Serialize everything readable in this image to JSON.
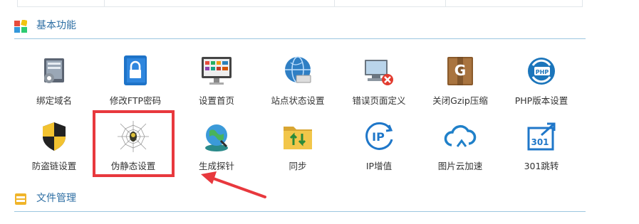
{
  "sections": {
    "basic": {
      "title": "基本功能",
      "icon": "grid-colorful-icon"
    },
    "files": {
      "title": "文件管理",
      "icon": "folder-cabinet-icon"
    }
  },
  "row1": [
    {
      "label": "绑定域名",
      "icon": "domain-bind-icon"
    },
    {
      "label": "修改FTP密码",
      "icon": "lock-icon"
    },
    {
      "label": "设置首页",
      "icon": "monitor-icon"
    },
    {
      "label": "站点状态设置",
      "icon": "globe-icon"
    },
    {
      "label": "错误页面定义",
      "icon": "error-computer-icon"
    },
    {
      "label": "关闭Gzip压缩",
      "icon": "gzip-box-icon"
    },
    {
      "label": "PHP版本设置",
      "icon": "php-version-icon"
    }
  ],
  "row2": [
    {
      "label": "防盗链设置",
      "icon": "shield-icon"
    },
    {
      "label": "伪静态设置",
      "icon": "spider-web-icon"
    },
    {
      "label": "生成探针",
      "icon": "probe-globe-icon"
    },
    {
      "label": "同步",
      "icon": "sync-folder-icon"
    },
    {
      "label": "IP增值",
      "icon": "ip-icon"
    },
    {
      "label": "图片云加速",
      "icon": "cloud-icon"
    },
    {
      "label": "301跳转",
      "icon": "redirect-301-icon"
    }
  ],
  "colors": {
    "accent": "#2d6ea3",
    "highlight": "#e8383d",
    "divider": "#9cc6e0"
  }
}
